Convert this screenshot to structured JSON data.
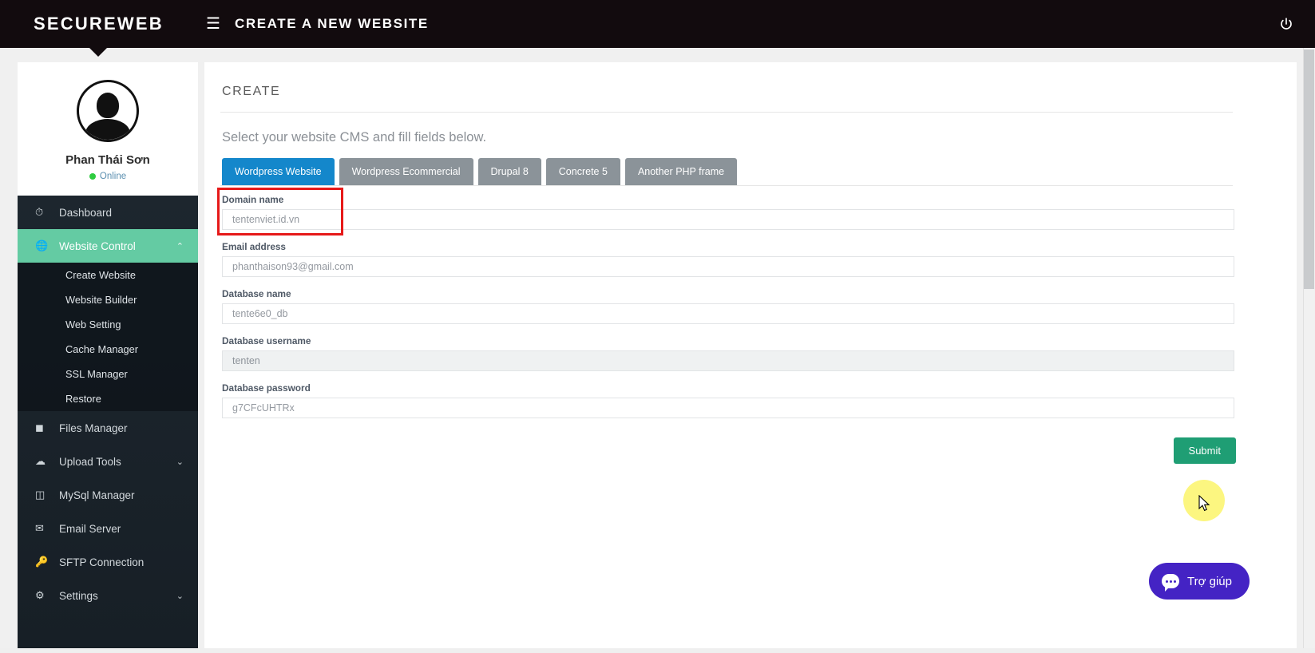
{
  "header": {
    "brand": "SECUREWEB",
    "menu_icon": "hamburger-icon",
    "page_title": "CREATE A NEW WEBSITE",
    "power_icon": "power-icon"
  },
  "sidebar": {
    "profile": {
      "name": "Phan Thái Sơn",
      "status": "Online",
      "status_color": "#2ecc40",
      "avatar_icon": "user-avatar-icon"
    },
    "items": [
      {
        "label": "Dashboard",
        "icon": "speedometer-icon",
        "active": false,
        "caret": ""
      },
      {
        "label": "Website Control",
        "icon": "globe-icon",
        "active": true,
        "caret": "⌃"
      },
      {
        "label": "Files Manager",
        "icon": "folder-icon",
        "active": false,
        "caret": ""
      },
      {
        "label": "Upload Tools",
        "icon": "cloud-upload-icon",
        "active": false,
        "caret": "⌄"
      },
      {
        "label": "MySql Manager",
        "icon": "database-icon",
        "active": false,
        "caret": ""
      },
      {
        "label": "Email Server",
        "icon": "envelope-icon",
        "active": false,
        "caret": ""
      },
      {
        "label": "SFTP Connection",
        "icon": "key-icon",
        "active": false,
        "caret": ""
      },
      {
        "label": "Settings",
        "icon": "gears-icon",
        "active": false,
        "caret": "⌄"
      }
    ],
    "submenu": [
      {
        "label": "Create Website"
      },
      {
        "label": "Website Builder"
      },
      {
        "label": "Web Setting"
      },
      {
        "label": "Cache Manager"
      },
      {
        "label": "SSL Manager"
      },
      {
        "label": "Restore"
      }
    ]
  },
  "main": {
    "title": "CREATE",
    "subtitle": "Select your website CMS and fill fields below.",
    "tabs": [
      {
        "label": "Wordpress Website",
        "active": true
      },
      {
        "label": "Wordpress Ecommercial",
        "active": false
      },
      {
        "label": "Drupal 8",
        "active": false
      },
      {
        "label": "Concrete 5",
        "active": false
      },
      {
        "label": "Another PHP frame",
        "active": false
      }
    ],
    "fields": [
      {
        "label": "Domain name",
        "value": "tentenviet.id.vn",
        "disabled": false,
        "highlighted": true
      },
      {
        "label": "Email address",
        "value": "phanthaison93@gmail.com",
        "disabled": false,
        "highlighted": false
      },
      {
        "label": "Database name",
        "value": "tente6e0_db",
        "disabled": false,
        "highlighted": false
      },
      {
        "label": "Database username",
        "value": "tenten",
        "disabled": true,
        "highlighted": false
      },
      {
        "label": "Database password",
        "value": "g7CFcUHTRx",
        "disabled": false,
        "highlighted": false
      }
    ],
    "submit_label": "Submit"
  },
  "chat": {
    "label": "Trợ giúp",
    "icon": "chat-bubble-icon",
    "color": "#4423c4"
  },
  "colors": {
    "accent_green": "#64cba3",
    "tab_active_blue": "#1487cb",
    "submit_green": "#1f9e74",
    "highlight_red": "#e61919",
    "header_dark": "#120b0e"
  }
}
